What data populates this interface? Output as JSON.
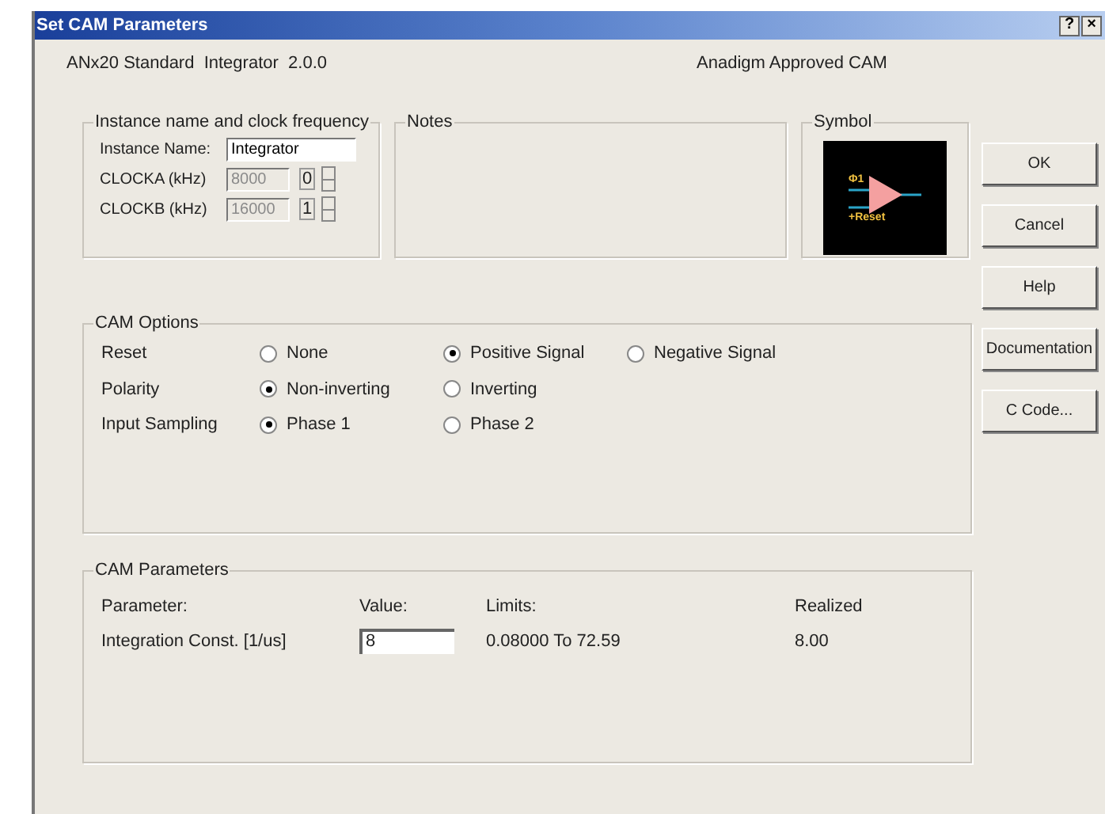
{
  "window": {
    "title": "Set CAM Parameters",
    "title_buttons": [
      "?",
      "×"
    ]
  },
  "header": {
    "product": "ANx20 Standard  Integrator  2.0.0",
    "approval": "Anadigm Approved CAM"
  },
  "instance_group": {
    "title": "Instance name and clock frequency",
    "fields": [
      {
        "label": "Instance Name:",
        "value": "Integrator",
        "disabled": false
      },
      {
        "label": "CLOCKA (kHz)",
        "value": "8000",
        "disabled": true,
        "spin_value": "0"
      },
      {
        "label": "CLOCKB (kHz)",
        "value": "16000",
        "disabled": true,
        "spin_value": "1"
      }
    ]
  },
  "notes": {
    "title": "Notes"
  },
  "symbol": {
    "title": "Symbol",
    "labels": [
      "Φ1",
      "+Reset"
    ]
  },
  "buttons": [
    "OK",
    "Cancel",
    "Help",
    "Documentation",
    "C Code..."
  ],
  "cam_options": {
    "title": "CAM Options",
    "rows": [
      {
        "label": "Reset",
        "options": [
          {
            "label": "None",
            "selected": false
          },
          {
            "label": "Positive Signal",
            "selected": true
          },
          {
            "label": "Negative Signal",
            "selected": false
          }
        ]
      },
      {
        "label": "Polarity",
        "options": [
          {
            "label": "Non-inverting",
            "selected": true
          },
          {
            "label": "Inverting",
            "selected": false
          }
        ]
      },
      {
        "label": "Input Sampling",
        "options": [
          {
            "label": "Phase 1",
            "selected": true
          },
          {
            "label": "Phase 2",
            "selected": false
          }
        ]
      }
    ]
  },
  "cam_parameters": {
    "title": "CAM Parameters",
    "columns": [
      "Parameter:",
      "Value:",
      "Limits:",
      "Realized"
    ],
    "rows": [
      {
        "parameter": "Integration Const. [1/us]",
        "value": "8",
        "limits": "0.08000 To 72.59",
        "realized": "8.00"
      }
    ]
  }
}
